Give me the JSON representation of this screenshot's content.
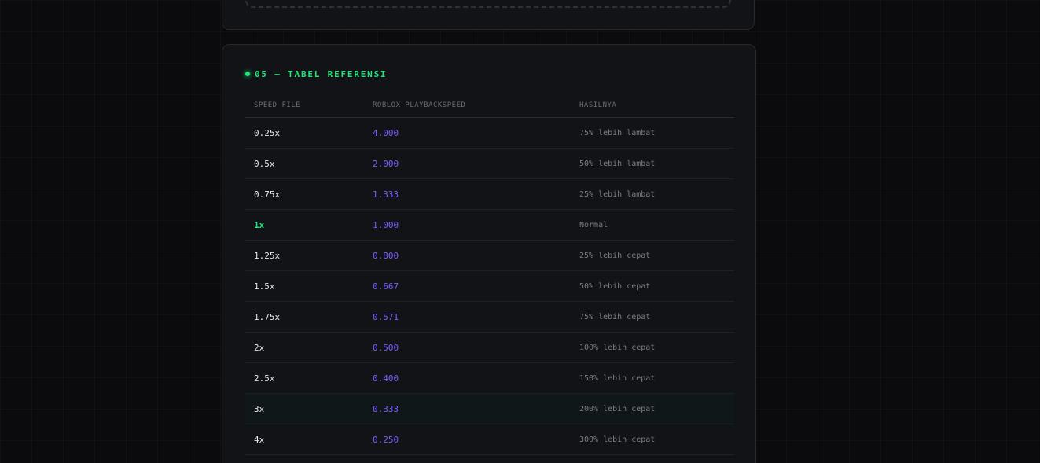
{
  "section": {
    "number_title": "05 — TABEL REFERENSI"
  },
  "table": {
    "headers": [
      "SPEED FILE",
      "ROBLOX PLAYBACKSPEED",
      "HASILNYA"
    ],
    "rows": [
      {
        "speed": "0.25x",
        "playback": "4.000",
        "result": "75% lebih lambat"
      },
      {
        "speed": "0.5x",
        "playback": "2.000",
        "result": "50% lebih lambat"
      },
      {
        "speed": "0.75x",
        "playback": "1.333",
        "result": "25% lebih lambat"
      },
      {
        "speed": "1x",
        "playback": "1.000",
        "result": "Normal"
      },
      {
        "speed": "1.25x",
        "playback": "0.800",
        "result": "25% lebih cepat"
      },
      {
        "speed": "1.5x",
        "playback": "0.667",
        "result": "50% lebih cepat"
      },
      {
        "speed": "1.75x",
        "playback": "0.571",
        "result": "75% lebih cepat"
      },
      {
        "speed": "2x",
        "playback": "0.500",
        "result": "100% lebih cepat"
      },
      {
        "speed": "2.5x",
        "playback": "0.400",
        "result": "150% lebih cepat"
      },
      {
        "speed": "3x",
        "playback": "0.333",
        "result": "200% lebih cepat"
      },
      {
        "speed": "4x",
        "playback": "0.250",
        "result": "300% lebih cepat"
      }
    ]
  },
  "colors": {
    "accent_green": "#22e57a",
    "accent_purple": "#7c5cff",
    "background": "#0b0b0e",
    "card": "#121317"
  }
}
